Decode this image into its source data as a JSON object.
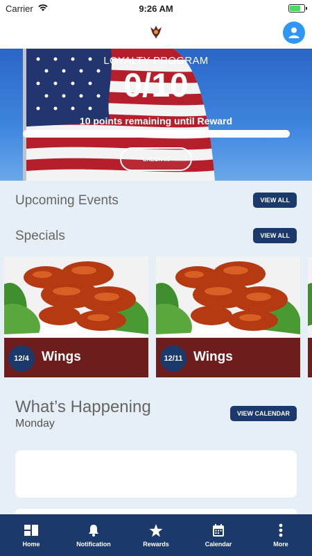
{
  "status_bar": {
    "carrier": "Carrier",
    "time": "9:26 AM",
    "battery_level": 0.7
  },
  "header": {
    "logo_icon": "eagle-emblem-icon",
    "avatar_icon": "user-icon",
    "avatar_color": "#2f97f3"
  },
  "loyalty": {
    "title": "LOYALTY PROGRAM",
    "count": "0/10",
    "remaining": "10 points remaining until Reward",
    "progress": 0,
    "checkin_label": "CHECK IN"
  },
  "upcoming_events": {
    "title": "Upcoming Events",
    "view_all_label": "VIEW ALL"
  },
  "specials": {
    "title": "Specials",
    "view_all_label": "VIEW ALL",
    "items": [
      {
        "date": "12/4",
        "name": "Wings"
      },
      {
        "date": "12/11",
        "name": "Wings"
      }
    ]
  },
  "happening": {
    "title": "What’s Happening",
    "day": "Monday",
    "view_calendar_label": "VIEW CALENDAR"
  },
  "tabbar": {
    "items": [
      {
        "label": "Home",
        "icon": "home-grid-icon"
      },
      {
        "label": "Notification",
        "icon": "bell-icon"
      },
      {
        "label": "Rewards",
        "icon": "star-icon"
      },
      {
        "label": "Calendar",
        "icon": "calendar-icon"
      },
      {
        "label": "More",
        "icon": "more-vertical-icon"
      }
    ]
  },
  "colors": {
    "navy": "#1b3a6b",
    "maroon": "#6e1d1d",
    "background": "#e6eef6"
  }
}
